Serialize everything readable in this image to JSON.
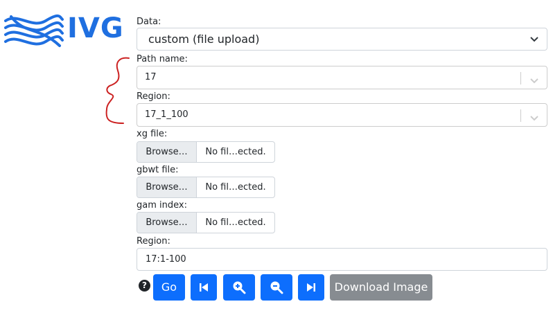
{
  "brand": {
    "logo_text": "IVG",
    "accent": "#1f6fe0"
  },
  "form": {
    "data_label": "Data:",
    "data_value": "custom (file upload)",
    "path_label": "Path name:",
    "path_value": "17",
    "region_select_label": "Region:",
    "region_select_value": "17_1_100",
    "xg_label": "xg file:",
    "gbwt_label": "gbwt file:",
    "gam_label": "gam index:",
    "browse_label": "Browse…",
    "no_file_label": "No fil…ected.",
    "region_input_label": "Region:",
    "region_input_value": "17:1-100"
  },
  "actions": {
    "help_symbol": "?",
    "go_label": "Go",
    "download_label": "Download Image",
    "icons": [
      "step-backward-icon",
      "zoom-in-icon",
      "zoom-out-icon",
      "step-forward-icon"
    ]
  },
  "colors": {
    "primary": "#0d6efd",
    "secondary": "#878c91",
    "annotation": "#cc2222"
  }
}
